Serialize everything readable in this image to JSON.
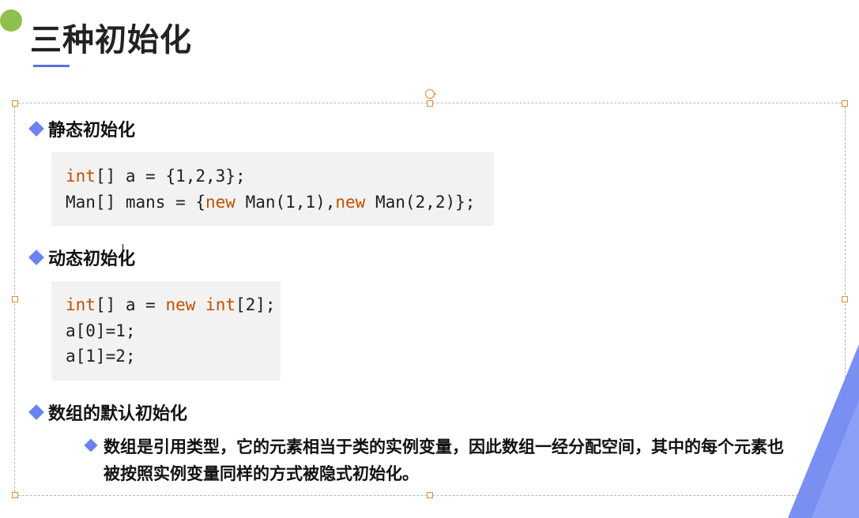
{
  "title": "三种初始化",
  "sections": [
    {
      "heading": "静态初始化",
      "code": {
        "line1_kw": "int",
        "line1_rest": "[] a = {1,2,3};",
        "line2_a": "Man[] mans = {",
        "line2_kw1": "new",
        "line2_b": " Man(1,1),",
        "line2_kw2": "new",
        "line2_c": " Man(2,2)};"
      }
    },
    {
      "heading": "动态初始化",
      "code": {
        "l1_kw1": "int",
        "l1_a": "[] a = ",
        "l1_kw2": "new",
        "l1_b": " ",
        "l1_kw3": "int",
        "l1_c": "[2];",
        "l2": "a[0]=1;",
        "l3": "a[1]=2;"
      }
    },
    {
      "heading": "数组的默认初始化",
      "sub": "数组是引用类型，它的元素相当于类的实例变量，因此数组一经分配空间，其中的每个元素也被按照实例变量同样的方式被隐式初始化。"
    }
  ]
}
